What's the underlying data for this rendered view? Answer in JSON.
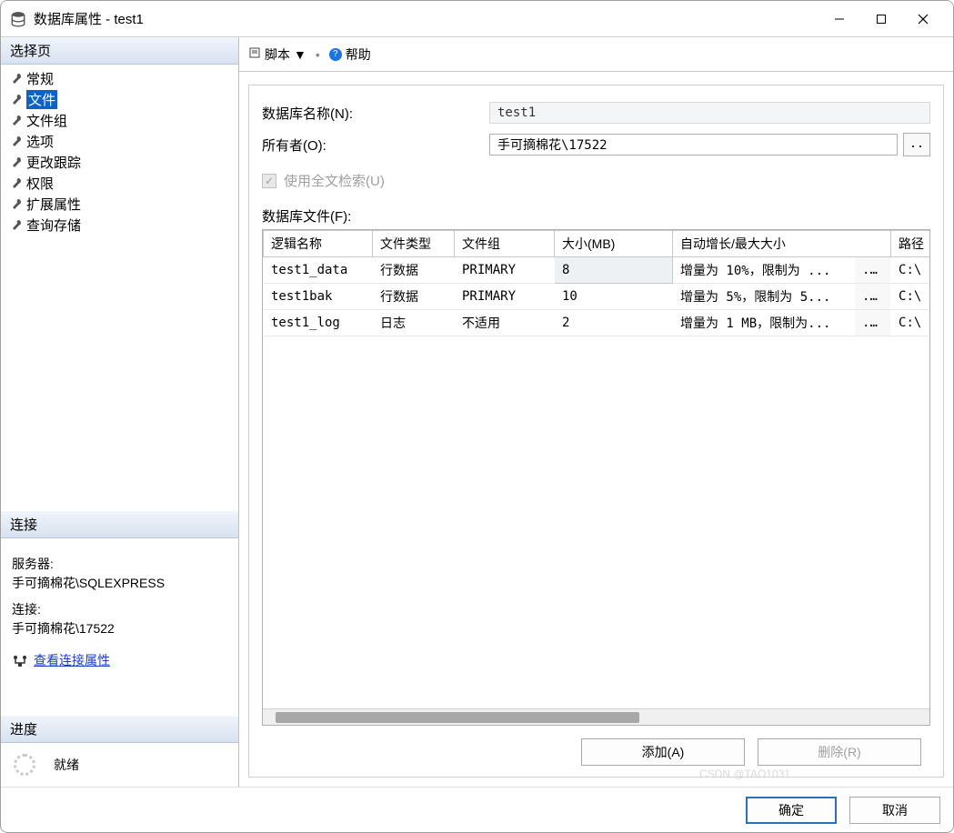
{
  "window": {
    "title": "数据库属性 - test1"
  },
  "sidebar": {
    "select_page_header": "选择页",
    "items": [
      {
        "label": "常规"
      },
      {
        "label": "文件"
      },
      {
        "label": "文件组"
      },
      {
        "label": "选项"
      },
      {
        "label": "更改跟踪"
      },
      {
        "label": "权限"
      },
      {
        "label": "扩展属性"
      },
      {
        "label": "查询存储"
      }
    ],
    "selected_index": 1,
    "connection_header": "连接",
    "server_label": "服务器:",
    "server_value": "手可摘棉花\\SQLEXPRESS",
    "conn_label": "连接:",
    "conn_value": "手可摘棉花\\17522",
    "view_conn_link": "查看连接属性",
    "progress_header": "进度",
    "progress_status": "就绪"
  },
  "toolbar": {
    "script_label": "脚本",
    "help_label": "帮助"
  },
  "form": {
    "db_name_label": "数据库名称(N):",
    "db_name_value": "test1",
    "owner_label": "所有者(O):",
    "owner_value": "手可摘棉花\\17522",
    "browse_dots": "..",
    "fulltext_label": "使用全文检索(U)",
    "files_label": "数据库文件(F):"
  },
  "grid": {
    "headers": {
      "logical_name": "逻辑名称",
      "file_type": "文件类型",
      "filegroup": "文件组",
      "size": "大小(MB)",
      "autogrowth": "自动增长/最大大小",
      "path": "路径"
    },
    "rows": [
      {
        "logical_name": "test1_data",
        "file_type": "行数据",
        "filegroup": "PRIMARY",
        "size": "8",
        "autogrowth": "增量为 10%，限制为 ...",
        "path": "C:\\"
      },
      {
        "logical_name": "test1bak",
        "file_type": "行数据",
        "filegroup": "PRIMARY",
        "size": "10",
        "autogrowth": "增量为 5%，限制为 5...",
        "path": "C:\\"
      },
      {
        "logical_name": "test1_log",
        "file_type": "日志",
        "filegroup": "不适用",
        "size": "2",
        "autogrowth": "增量为 1 MB，限制为...",
        "path": "C:\\"
      }
    ],
    "dots": "..."
  },
  "buttons": {
    "add": "添加(A)",
    "remove": "删除(R)",
    "ok": "确定",
    "cancel": "取消"
  },
  "watermark": "CSDN @TAO1031"
}
